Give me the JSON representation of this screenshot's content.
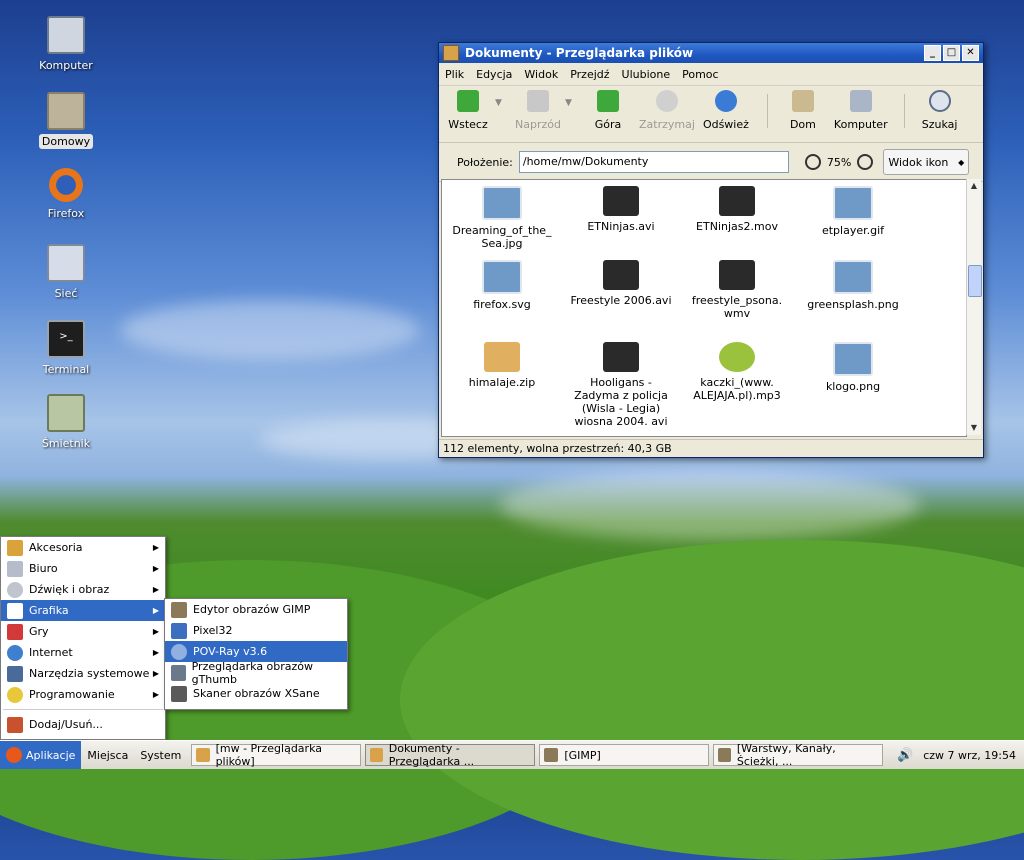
{
  "desktop": {
    "icons": [
      {
        "label": "Komputer"
      },
      {
        "label": "Domowy"
      },
      {
        "label": "Firefox"
      },
      {
        "label": "Sieć"
      },
      {
        "label": "Terminal"
      },
      {
        "label": "Śmietnik"
      }
    ]
  },
  "window": {
    "title": "Dokumenty - Przeglądarka plików",
    "menu": [
      "Plik",
      "Edycja",
      "Widok",
      "Przejdź",
      "Ulubione",
      "Pomoc"
    ],
    "toolbar": {
      "back": "Wstecz",
      "forward": "Naprzód",
      "up": "Góra",
      "stop": "Zatrzymaj",
      "reload": "Odśwież",
      "home": "Dom",
      "computer": "Komputer",
      "search": "Szukaj"
    },
    "location_label": "Położenie:",
    "location_value": "/home/mw/Dokumenty",
    "zoom": "75%",
    "view": "Widok ikon",
    "files": [
      {
        "name": "Dreaming_of_the_ Sea.jpg",
        "type": "image"
      },
      {
        "name": "ETNinjas.avi",
        "type": "video"
      },
      {
        "name": "ETNinjas2.mov",
        "type": "video"
      },
      {
        "name": "etplayer.gif",
        "type": "image"
      },
      {
        "name": "firefox.svg",
        "type": "image"
      },
      {
        "name": "Freestyle 2006.avi",
        "type": "video"
      },
      {
        "name": "freestyle_psona. wmv",
        "type": "video"
      },
      {
        "name": "greensplash.png",
        "type": "image"
      },
      {
        "name": "himalaje.zip",
        "type": "archive"
      },
      {
        "name": "Hooligans - Zadyma z policja (Wisla - Legia) wiosna 2004. avi",
        "type": "video"
      },
      {
        "name": "kaczki_(www. ALEJAJA.pl).mp3",
        "type": "audio"
      },
      {
        "name": "klogo.png",
        "type": "image"
      }
    ],
    "status": "112 elementy, wolna przestrzeń: 40,3 GB"
  },
  "menu_main": [
    {
      "label": "Akcesoria"
    },
    {
      "label": "Biuro"
    },
    {
      "label": "Dźwięk i obraz"
    },
    {
      "label": "Grafika"
    },
    {
      "label": "Gry"
    },
    {
      "label": "Internet"
    },
    {
      "label": "Narzędzia systemowe"
    },
    {
      "label": "Programowanie"
    },
    {
      "label": "Dodaj/Usuń..."
    }
  ],
  "menu_sub": [
    {
      "label": "Edytor obrazów GIMP"
    },
    {
      "label": "Pixel32"
    },
    {
      "label": "POV-Ray v3.6"
    },
    {
      "label": "Przeglądarka obrazów gThumb"
    },
    {
      "label": "Skaner obrazów XSane"
    }
  ],
  "taskbar": {
    "apps": "Aplikacje",
    "places": "Miejsca",
    "system": "System",
    "tasks": [
      "[mw - Przeglądarka plików]",
      "Dokumenty - Przeglądarka ...",
      "[GIMP]",
      "[Warstwy, Kanały, Ścieżki, ..."
    ],
    "clock": "czw  7 wrz, 19:54"
  }
}
